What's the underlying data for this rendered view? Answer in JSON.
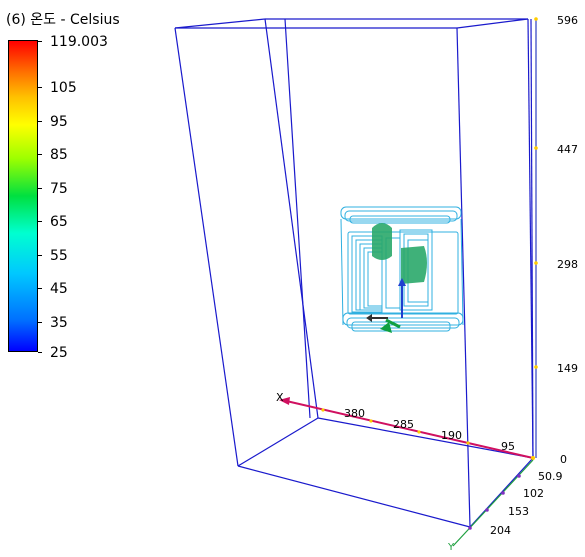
{
  "legend": {
    "title": "(6) 온도 - Celsius",
    "ticks": [
      "119.003",
      "105",
      "95",
      "85",
      "75",
      "65",
      "55",
      "45",
      "35",
      "25"
    ]
  },
  "axes": {
    "x_axis_label": "X",
    "y_axis_label": "Y",
    "x_ticks": [
      "380",
      "285",
      "190",
      "95",
      "0"
    ],
    "z_ticks": [
      "596",
      "447",
      "298",
      "149"
    ],
    "y_ticks": [
      "50.9",
      "102",
      "153",
      "204"
    ]
  },
  "colors": {
    "box_edge": "#1a1acc",
    "x_axis": "#d01060",
    "y_axis": "#20a040",
    "z_axis": "#3040c0",
    "isosurface_outline": "#30b0e0",
    "isosurface_fill": "#2aa86a"
  }
}
